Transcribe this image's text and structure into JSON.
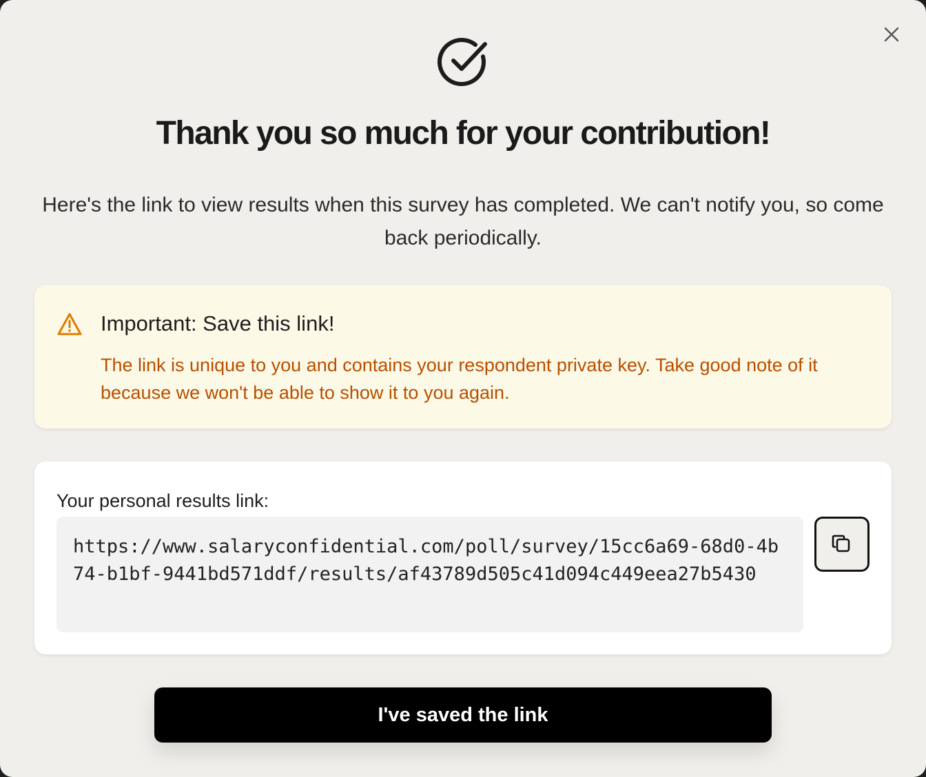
{
  "modal": {
    "title": "Thank you so much for your contribution!",
    "subtitle": "Here's the link to view results when this survey has completed. We can't notify you, so come back periodically.",
    "icons": {
      "close": "close-icon",
      "success": "check-circle-icon",
      "warning": "warning-triangle-icon",
      "copy": "copy-icon"
    }
  },
  "warning": {
    "title": "Important: Save this link!",
    "text": "The link is unique to you and contains your respondent private key. Take good note of it because we won't be able to show it to you again.",
    "accent_color": "#b84f00",
    "icon_color": "#e07a00",
    "background": "#fdf9e7"
  },
  "results_link": {
    "label": "Your personal results link:",
    "url": "https://www.salaryconfidential.com/poll/survey/15cc6a69-68d0-4b74-b1bf-9441bd571ddf/results/af43789d505c41d094c449eea27b5430"
  },
  "actions": {
    "confirm_label": "I've saved the link"
  }
}
